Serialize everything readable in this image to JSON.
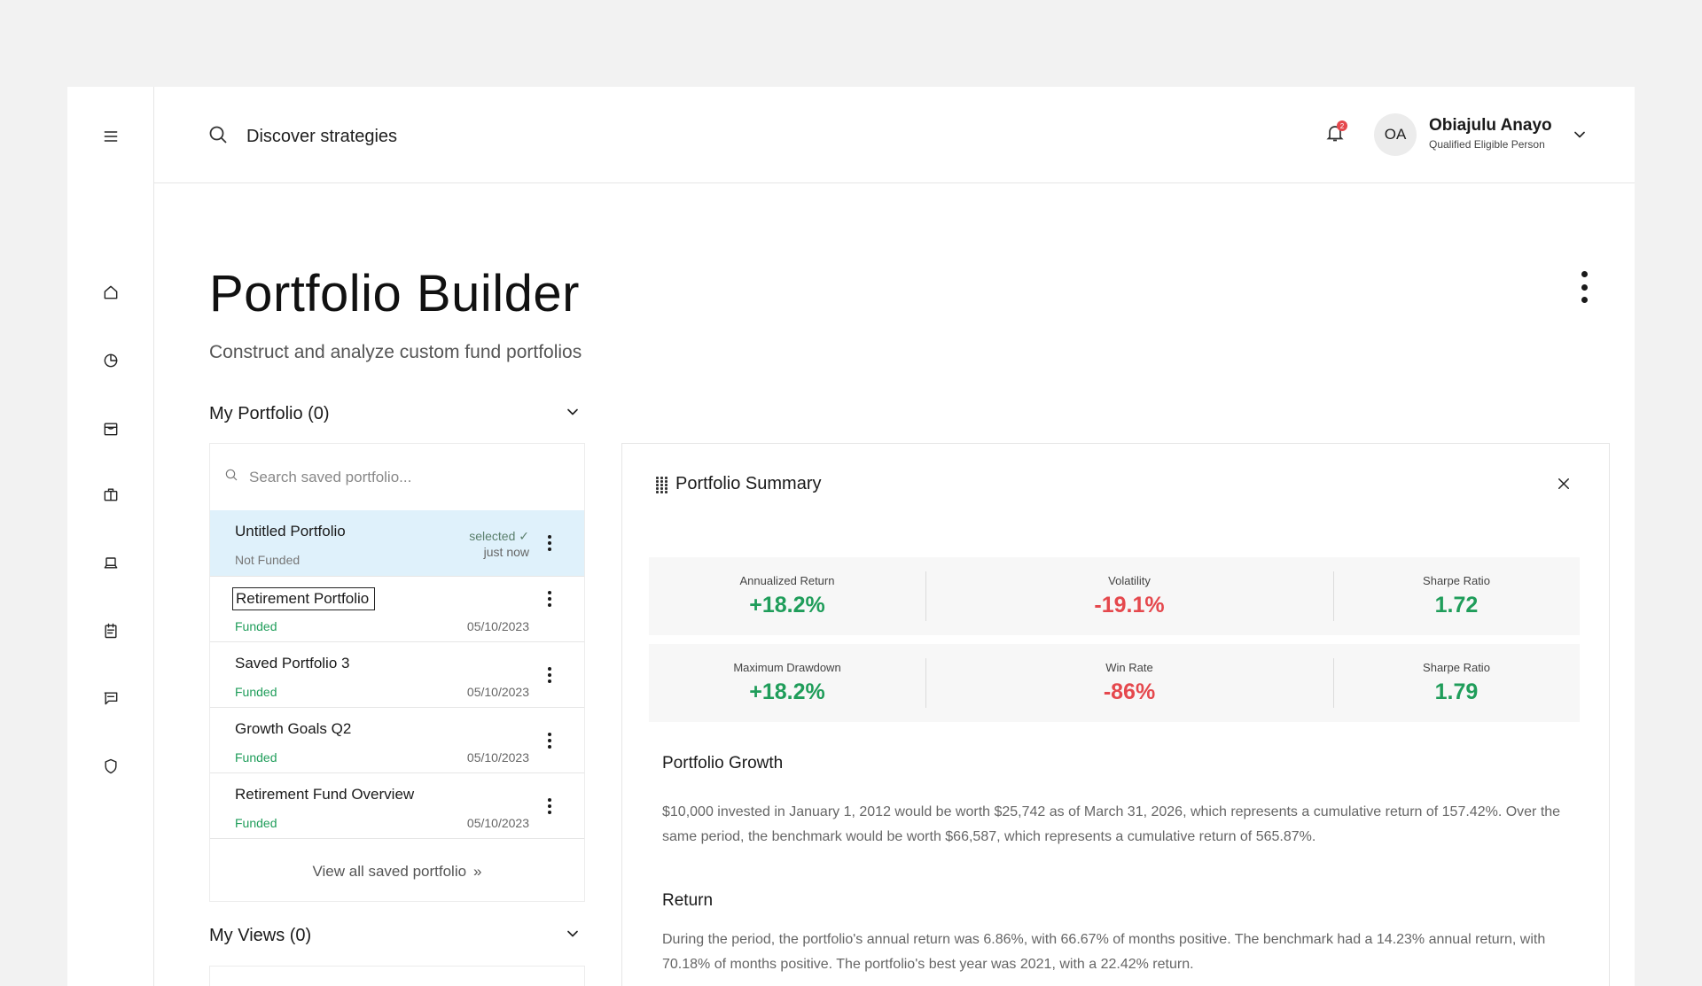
{
  "header": {
    "search_label": "Discover strategies",
    "notification_count": "2",
    "user": {
      "initials": "OA",
      "name": "Obiajulu Anayo",
      "role": "Qualified Eligible Person"
    }
  },
  "page": {
    "title": "Portfolio Builder",
    "subtitle": "Construct and analyze custom fund portfolios"
  },
  "my_portfolio": {
    "header": "My Portfolio (0)",
    "search_placeholder": "Search saved portfolio...",
    "selected_item": {
      "name": "Untitled Portfolio",
      "status": "Not Funded",
      "selected_label": "selected ✓",
      "time": "just now"
    },
    "items": [
      {
        "name": "Retirement Portfolio",
        "status": "Funded",
        "date": "05/10/2023"
      },
      {
        "name": "Saved Portfolio 3",
        "status": "Funded",
        "date": "05/10/2023"
      },
      {
        "name": "Growth Goals Q2",
        "status": "Funded",
        "date": "05/10/2023"
      },
      {
        "name": "Retirement Fund Overview",
        "status": "Funded",
        "date": "05/10/2023"
      }
    ],
    "view_all": "View all saved portfolio",
    "view_all_icon": "»"
  },
  "my_views": {
    "header": "My Views (0)"
  },
  "summary": {
    "title": "Portfolio Summary",
    "metrics_row1": [
      {
        "label": "Annualized Return",
        "value": "+18.2%"
      },
      {
        "label": "Volatility",
        "value": "-19.1%"
      },
      {
        "label": "Sharpe Ratio",
        "value": "1.72"
      }
    ],
    "metrics_row2": [
      {
        "label": "Maximum Drawdown",
        "value": "+18.2%"
      },
      {
        "label": "Win Rate",
        "value": "-86%"
      },
      {
        "label": "Sharpe Ratio",
        "value": "1.79"
      }
    ],
    "growth": {
      "heading": "Portfolio Growth",
      "text": "$10,000 invested in January 1, 2012 would be worth $25,742 as of March 31, 2026, which represents a cumulative return of 157.42%. Over the same period, the benchmark would be worth $66,587, which represents a cumulative return of 565.87%."
    },
    "return": {
      "heading": "Return",
      "text": "During the period, the portfolio's annual return was 6.86%, with 66.67% of months positive. The benchmark had a 14.23% annual return, with 70.18% of months positive. The portfolio's best year was 2021, with a 22.42% return."
    }
  },
  "colors": {
    "positive": "#1f9d5a",
    "negative": "#e5484d",
    "selected_row": "#dff1fb"
  },
  "icons": [
    "menu-icon",
    "home-icon",
    "pie-chart-icon",
    "store-icon",
    "briefcase-icon",
    "laptop-icon",
    "clipboard-icon",
    "chat-icon",
    "shield-icon",
    "search-icon",
    "bell-icon",
    "chevron-down-icon",
    "kebab-icon",
    "close-icon",
    "grip-icon"
  ]
}
